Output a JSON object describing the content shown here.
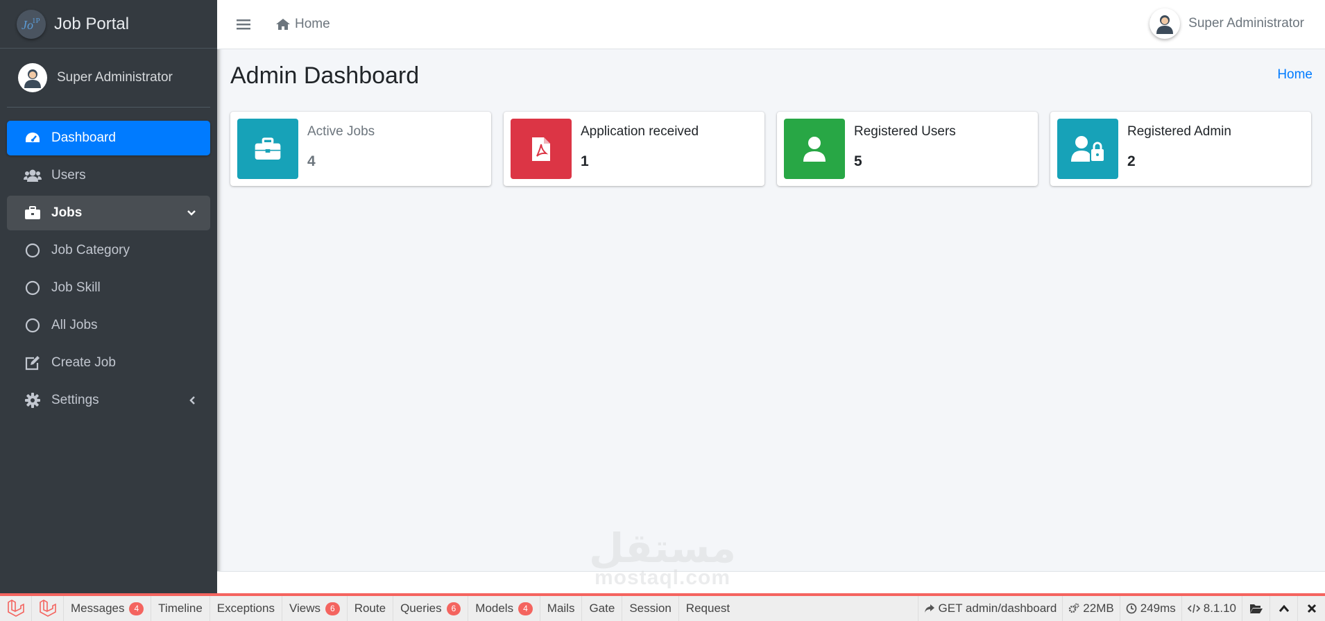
{
  "brand": {
    "name": "Job Portal"
  },
  "sidebar": {
    "user_name": "Super Administrator",
    "items": [
      {
        "label": "Dashboard",
        "icon": "tachometer-icon"
      },
      {
        "label": "Users",
        "icon": "users-icon"
      },
      {
        "label": "Jobs",
        "icon": "briefcase-icon"
      },
      {
        "label": "Job Category",
        "icon": "circle-icon"
      },
      {
        "label": "Job Skill",
        "icon": "circle-icon"
      },
      {
        "label": "All Jobs",
        "icon": "circle-icon"
      },
      {
        "label": "Create Job",
        "icon": "edit-icon"
      },
      {
        "label": "Settings",
        "icon": "gear-icon"
      }
    ]
  },
  "topbar": {
    "home_label": "Home",
    "user_name": "Super Administrator"
  },
  "page": {
    "title": "Admin Dashboard",
    "breadcrumb": "Home"
  },
  "cards": [
    {
      "label": "Active Jobs",
      "value": "4",
      "color": "#17a2b8",
      "icon": "briefcase-icon"
    },
    {
      "label": "Application received",
      "value": "1",
      "color": "#dc3545",
      "icon": "file-pdf-icon"
    },
    {
      "label": "Registered Users",
      "value": "5",
      "color": "#28a745",
      "icon": "user-icon"
    },
    {
      "label": "Registered Admin",
      "value": "2",
      "color": "#17a2b8",
      "icon": "user-lock-icon"
    }
  ],
  "watermark": {
    "arabic": "مستقل",
    "latin": "mostaql.com"
  },
  "debugbar": {
    "tabs": [
      {
        "label": "Messages",
        "badge": "4"
      },
      {
        "label": "Timeline",
        "badge": ""
      },
      {
        "label": "Exceptions",
        "badge": ""
      },
      {
        "label": "Views",
        "badge": "6"
      },
      {
        "label": "Route",
        "badge": ""
      },
      {
        "label": "Queries",
        "badge": "6"
      },
      {
        "label": "Models",
        "badge": "4"
      },
      {
        "label": "Mails",
        "badge": ""
      },
      {
        "label": "Gate",
        "badge": ""
      },
      {
        "label": "Session",
        "badge": ""
      },
      {
        "label": "Request",
        "badge": ""
      }
    ],
    "request": "GET admin/dashboard",
    "memory": "22MB",
    "time": "249ms",
    "version": "8.1.10"
  },
  "colors": {
    "accent": "#007bff",
    "sidebar_bg": "#343a40",
    "debug_accent": "#f4645f"
  }
}
